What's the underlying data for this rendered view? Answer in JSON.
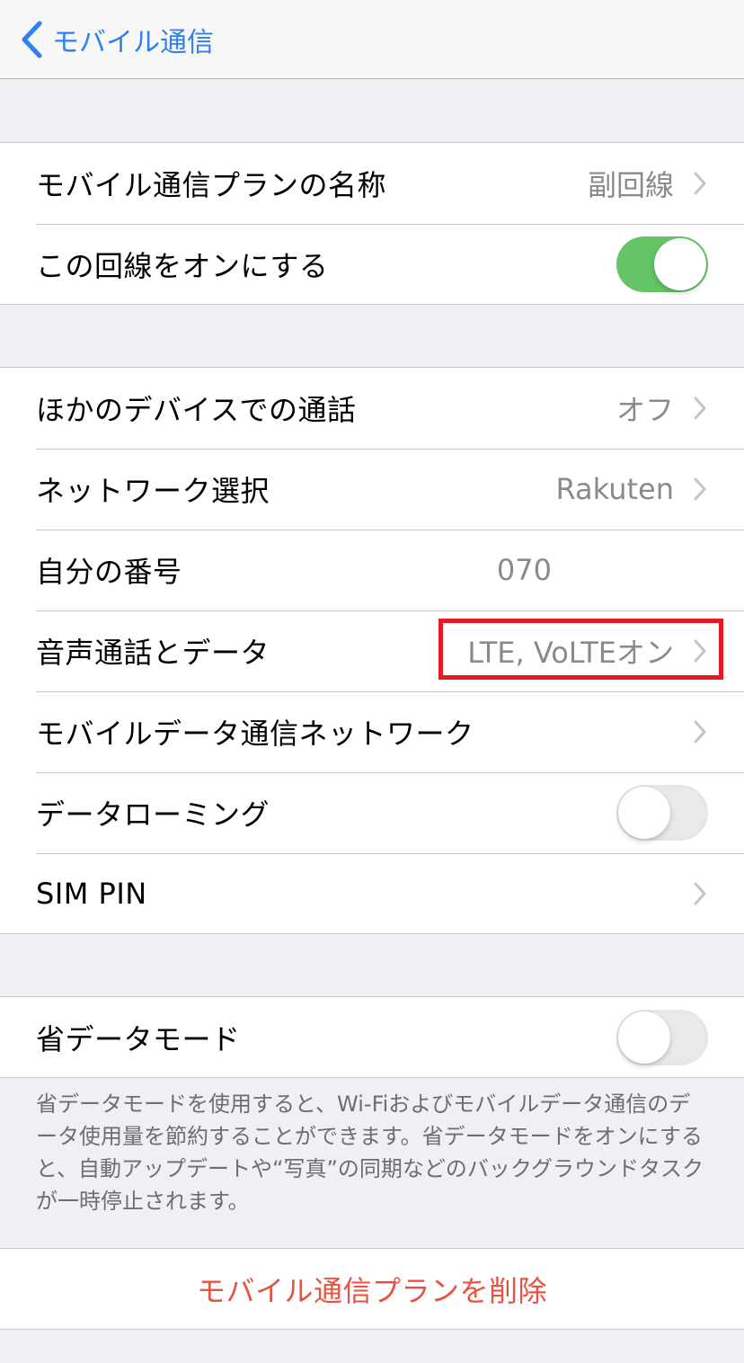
{
  "colors": {
    "accent": "#2f7ff0",
    "toggle_on": "#63c565",
    "destructive": "#e8523f",
    "highlight_box": "#e31b23"
  },
  "navbar": {
    "back_label": "モバイル通信",
    "back_icon": "chevron-left-icon"
  },
  "section1": {
    "plan_name": {
      "label": "モバイル通信プランの名称",
      "value": "副回線"
    },
    "line_on": {
      "label": "この回線をオンにする",
      "state": true
    }
  },
  "section2": {
    "other_devices": {
      "label": "ほかのデバイスでの通話",
      "value": "オフ"
    },
    "network_selection": {
      "label": "ネットワーク選択",
      "value": "Rakuten"
    },
    "my_number": {
      "label": "自分の番号",
      "value": "070"
    },
    "voice_data": {
      "label": "音声通話とデータ",
      "value": "LTE, VoLTEオン"
    },
    "mobile_data_network": {
      "label": "モバイルデータ通信ネットワーク"
    },
    "data_roaming": {
      "label": "データローミング",
      "state": false
    },
    "sim_pin": {
      "label": "SIM PIN"
    }
  },
  "section3": {
    "low_data_mode": {
      "label": "省データモード",
      "state": false
    },
    "footnote": "省データモードを使用すると、Wi-Fiおよびモバイルデータ通信のデータ使用量を節約することができます。省データモードをオンにすると、自動アップデートや“写真”の同期などのバックグラウンドタスクが一時停止されます。"
  },
  "section4": {
    "delete_plan": "モバイル通信プランを削除"
  }
}
